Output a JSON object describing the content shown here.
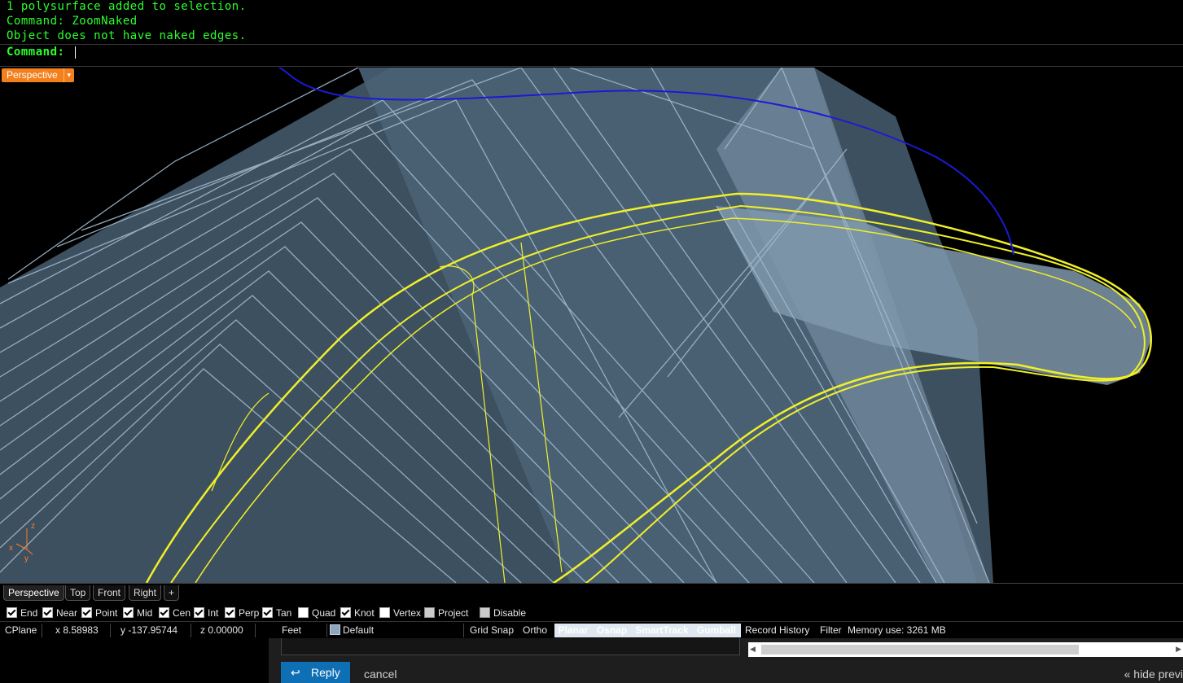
{
  "command_history": {
    "lines": [
      "1 polysurface added to selection.",
      "Command: ZoomNaked",
      "Object does not have naked edges."
    ]
  },
  "command_prompt": {
    "label": "Command:"
  },
  "viewport": {
    "active_label": "Perspective",
    "axis": {
      "x": "x",
      "y": "y",
      "z": "z"
    }
  },
  "viewport_tabs": [
    "Perspective",
    "Top",
    "Front",
    "Right"
  ],
  "viewport_add_icon": "+",
  "osnaps": [
    {
      "label": "End",
      "checked": true
    },
    {
      "label": "Near",
      "checked": true
    },
    {
      "label": "Point",
      "checked": true
    },
    {
      "label": "Mid",
      "checked": true
    },
    {
      "label": "Cen",
      "checked": true
    },
    {
      "label": "Int",
      "checked": true
    },
    {
      "label": "Perp",
      "checked": true
    },
    {
      "label": "Tan",
      "checked": true
    },
    {
      "label": "Quad",
      "checked": false
    },
    {
      "label": "Knot",
      "checked": true
    },
    {
      "label": "Vertex",
      "checked": false
    },
    {
      "label": "Project",
      "checked": false
    },
    {
      "label": "Disable",
      "checked": false
    }
  ],
  "status": {
    "cplane": "CPlane",
    "x": "x 8.58983",
    "y": "y -137.95744",
    "z": "z 0.00000",
    "units": "Feet",
    "layer": "Default",
    "grid_snap": "Grid Snap",
    "ortho": "Ortho",
    "planar": "Planar",
    "osnap": "Osnap",
    "smarttrack": "SmartTrack",
    "gumball": "Gumball",
    "record_history": "Record History",
    "filter": "Filter",
    "memory": "Memory use: 3261 MB"
  },
  "reply": {
    "button": "Reply",
    "cancel": "cancel",
    "hide_preview": "« hide previ"
  },
  "colors": {
    "command_text": "#2bff2b",
    "viewport_tab": "#f47f1d",
    "selection_curves": "#f0f028",
    "surface": "#5a7488",
    "annotation": "#1a1ad6",
    "reply_button": "#0f6fb5"
  }
}
